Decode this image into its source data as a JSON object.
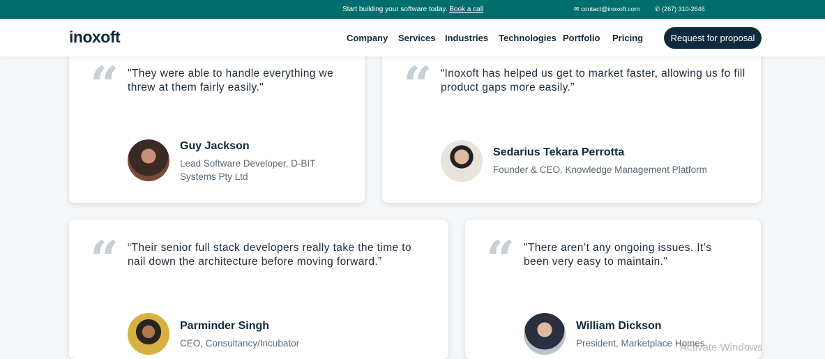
{
  "topbar": {
    "promo": "Start building your software today.",
    "promo_link": "Book a call",
    "email": "contact@inoxoft.com",
    "phone": "(267) 310-2646"
  },
  "header": {
    "logo": "inoxoft",
    "nav": [
      "Company",
      "Services",
      "Industries",
      "Technologies",
      "Portfolio",
      "Pricing"
    ],
    "cta": "Request for proposal"
  },
  "testimonials": [
    {
      "quote": "\"They were able to handle everything we threw at them fairly easily.\"",
      "name": "Guy Jackson",
      "role": "Lead Software Developer, D-BIT Systems Pty Ltd"
    },
    {
      "quote": "“Inoxoft has helped us get to market faster, allowing us fo fill product gaps more easily.”",
      "name": "Sedarius Tekara Perrotta",
      "role": "Founder & CEO, Knowledge Management Platform"
    },
    {
      "quote": "“Their senior full stack developers really take the time to nail down the architecture before moving forward.”",
      "name": "Parminder Singh",
      "role": "CEO, Consultancy/Incubator"
    },
    {
      "quote": "\"There aren’t any ongoing issues. It’s been very easy to maintain.\"",
      "name": "William Dickson",
      "role": "President, Marketplace Homes"
    }
  ],
  "watermark": "Activate Windows",
  "colors": {
    "topbar": "#006e6c",
    "navy": "#0f2a3c"
  }
}
